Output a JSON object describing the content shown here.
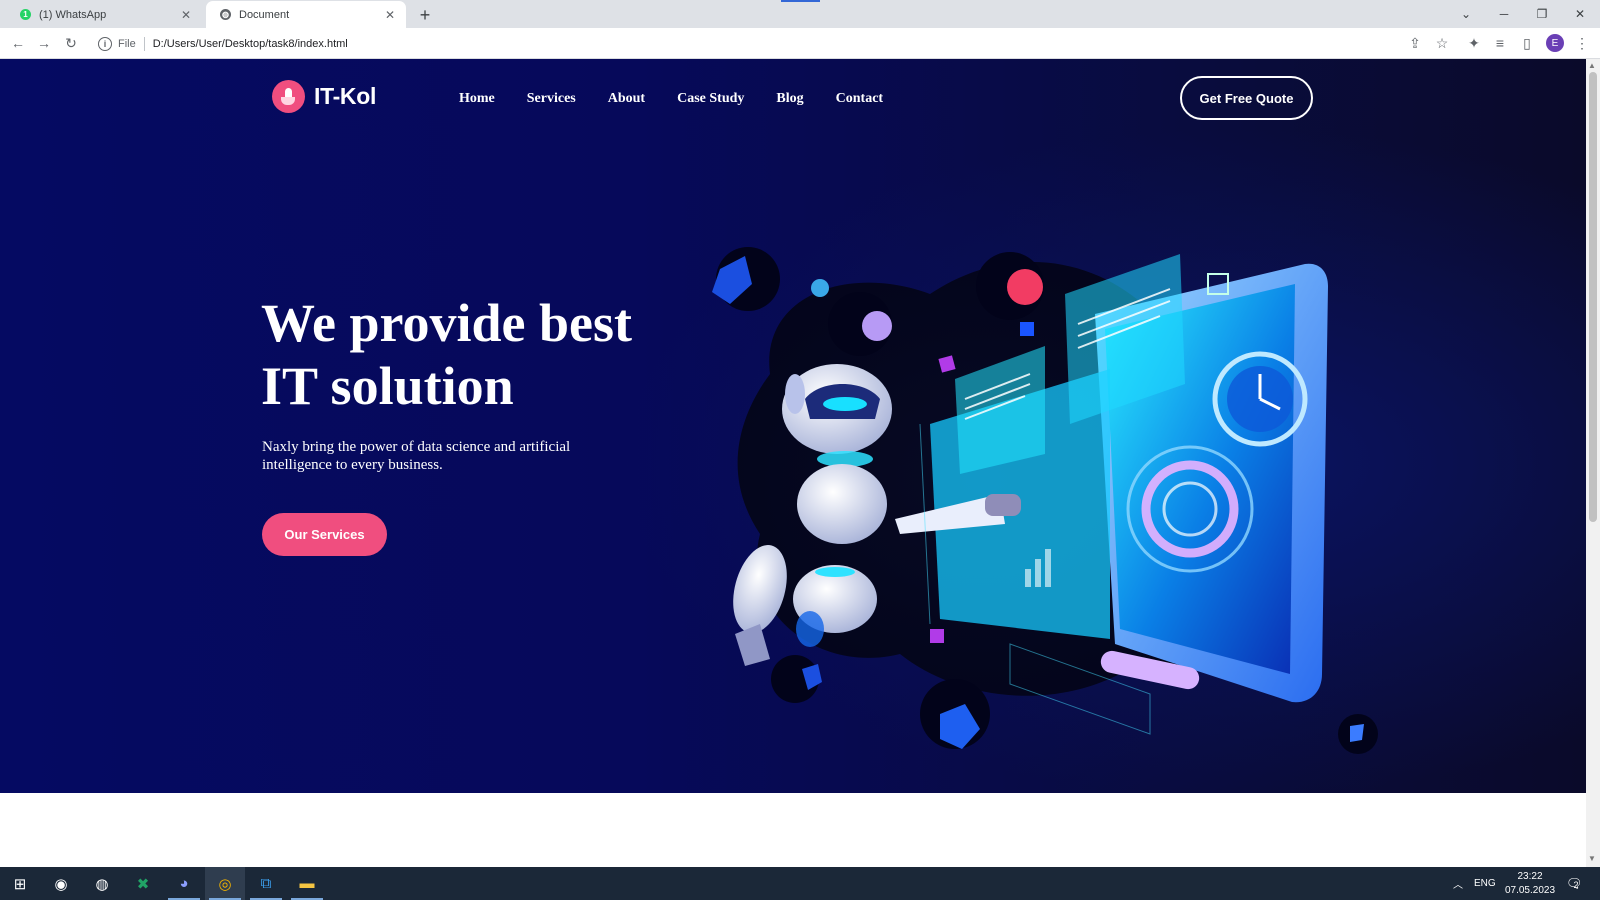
{
  "browser": {
    "tabs": [
      {
        "title": "(1) WhatsApp",
        "active": false
      },
      {
        "title": "Document",
        "active": true
      }
    ],
    "new_tab": "+",
    "address": {
      "scheme": "File",
      "url": "D:/Users/User/Desktop/task8/index.html"
    },
    "profile_initial": "E"
  },
  "site": {
    "brand": "IT-Kol",
    "nav": [
      "Home",
      "Services",
      "About",
      "Case Study",
      "Blog",
      "Contact"
    ],
    "quote_button": "Get Free Quote",
    "headline_line1": "We provide best",
    "headline_line2": "IT solution",
    "subtext": "Naxly bring the power of data science and artificial intelligence to every business.",
    "cta": "Our Services",
    "colors": {
      "accent": "#f04e7f",
      "hero_bg": "#06095a",
      "glow": "#19e6ff"
    }
  },
  "taskbar": {
    "apps": [
      "windows-start",
      "steam",
      "app-circle",
      "excel",
      "discord",
      "chrome",
      "vscode",
      "file-explorer"
    ],
    "language": "ENG",
    "time": "23:22",
    "date": "07.05.2023",
    "notification_count": "2"
  }
}
